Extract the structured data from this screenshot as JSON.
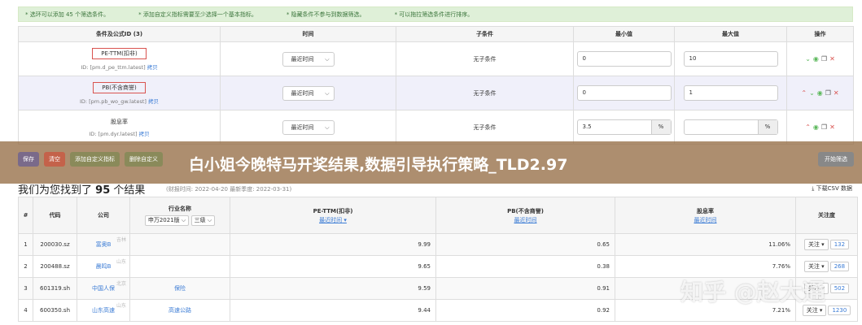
{
  "tips": [
    "* 选环可以添加 45 个筛选条件。",
    "* 添加自定义指标需要至少选择一个基本指标。",
    "* 隐藏条件不参与到数据筛选。",
    "* 可以拖拉筛选条件进行排序。"
  ],
  "conditions": {
    "headers": [
      "条件及公式ID (3)",
      "时间",
      "子条件",
      "最小值",
      "最大值",
      "操作"
    ],
    "rows": [
      {
        "name": "PE-TTM(扣非)",
        "id_prefix": "ID: [pm.d_pe_ttm.latest]",
        "copy": "拷贝",
        "time": "最近时间",
        "sub": "无子条件",
        "min": "0",
        "max": "10",
        "unit": ""
      },
      {
        "name": "PB(不含商誉)",
        "id_prefix": "ID: [pm.pb_wo_gw.latest]",
        "copy": "拷贝",
        "time": "最近时间",
        "sub": "无子条件",
        "min": "0",
        "max": "1",
        "unit": ""
      },
      {
        "name": "股息率",
        "id_prefix": "ID: [pm.dyr.latest]",
        "copy": "拷贝",
        "time": "最近时间",
        "sub": "无子条件",
        "min": "3.5",
        "max": "",
        "unit": "%"
      }
    ]
  },
  "toolbar": {
    "buttons": [
      "保存",
      "清空",
      "添加自定义指标",
      "删除自定义"
    ],
    "start": "开始筛选"
  },
  "headline": "白小姐今晚特马开奖结果,数据引导执行策略_TLD2.97",
  "results": {
    "title_prefix": "我们为您找到了",
    "count": "95",
    "title_suffix": "个结果",
    "date_info": "(财报时间: 2022-04-20 最新季度: 2022-03-31)",
    "download": "下载CSV 数据",
    "headers": {
      "idx": "#",
      "code": "代码",
      "company": "公司",
      "industry": "行业名称",
      "industry_std": "申万2021版",
      "industry_level": "三级",
      "pe": "PE-TTM(扣非)",
      "pb": "PB(不含商誉)",
      "dy": "股息率",
      "sort_label": "最近时间",
      "follow": "关注度"
    },
    "rows": [
      {
        "idx": "1",
        "code": "200030.sz",
        "company": "富奥B",
        "region": "吉林",
        "industry": "",
        "pe": "9.99",
        "pb": "0.65",
        "dy": "11.06%",
        "follow": "关注",
        "count": "132"
      },
      {
        "idx": "2",
        "code": "200488.sz",
        "company": "晨鸣B",
        "region": "山东",
        "industry": "",
        "pe": "9.65",
        "pb": "0.38",
        "dy": "7.76%",
        "follow": "关注",
        "count": "268"
      },
      {
        "idx": "3",
        "code": "601319.sh",
        "company": "中国人保",
        "region": "北京",
        "industry": "保险",
        "pe": "9.59",
        "pb": "0.91",
        "dy": "",
        "follow": "关注",
        "count": "502"
      },
      {
        "idx": "4",
        "code": "600350.sh",
        "company": "山东高速",
        "region": "山东",
        "industry": "高速公路",
        "pe": "9.44",
        "pb": "0.92",
        "dy": "7.21%",
        "follow": "关注",
        "count": "1230"
      }
    ]
  },
  "watermark": "知乎 @赵大通"
}
